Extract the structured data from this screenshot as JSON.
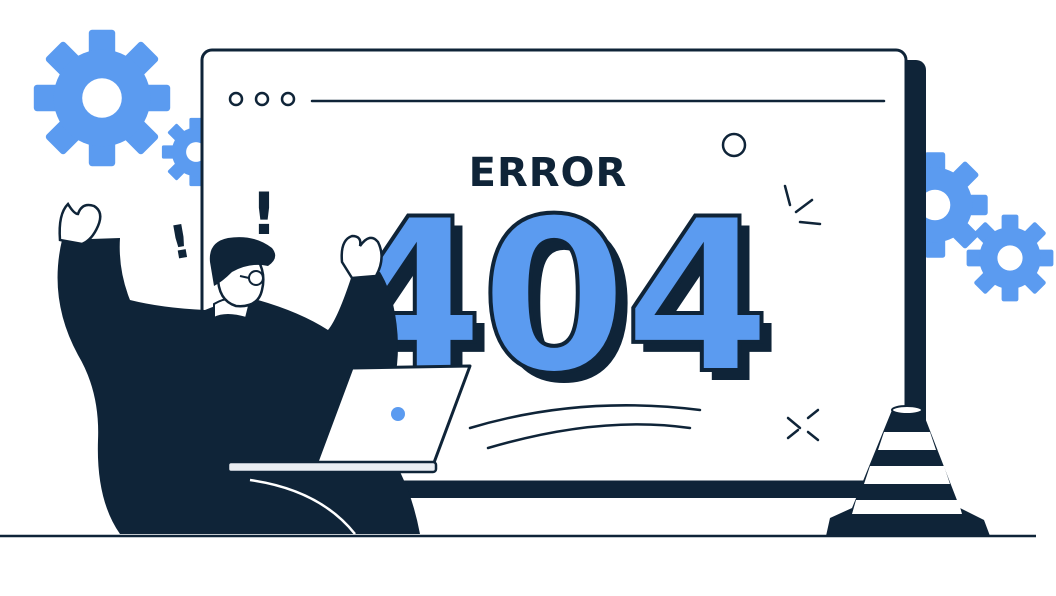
{
  "illustration": {
    "heading": "ERROR",
    "code": "404",
    "exclamation": "!"
  },
  "colors": {
    "navy": "#0f2438",
    "blue": "#5b9bf0",
    "white": "#ffffff",
    "light_gray": "#e9edf2"
  },
  "icons": [
    "gear-icon",
    "traffic-cone-icon",
    "exclamation-icon",
    "sparkle-icon",
    "laptop-icon",
    "browser-window-icon"
  ]
}
